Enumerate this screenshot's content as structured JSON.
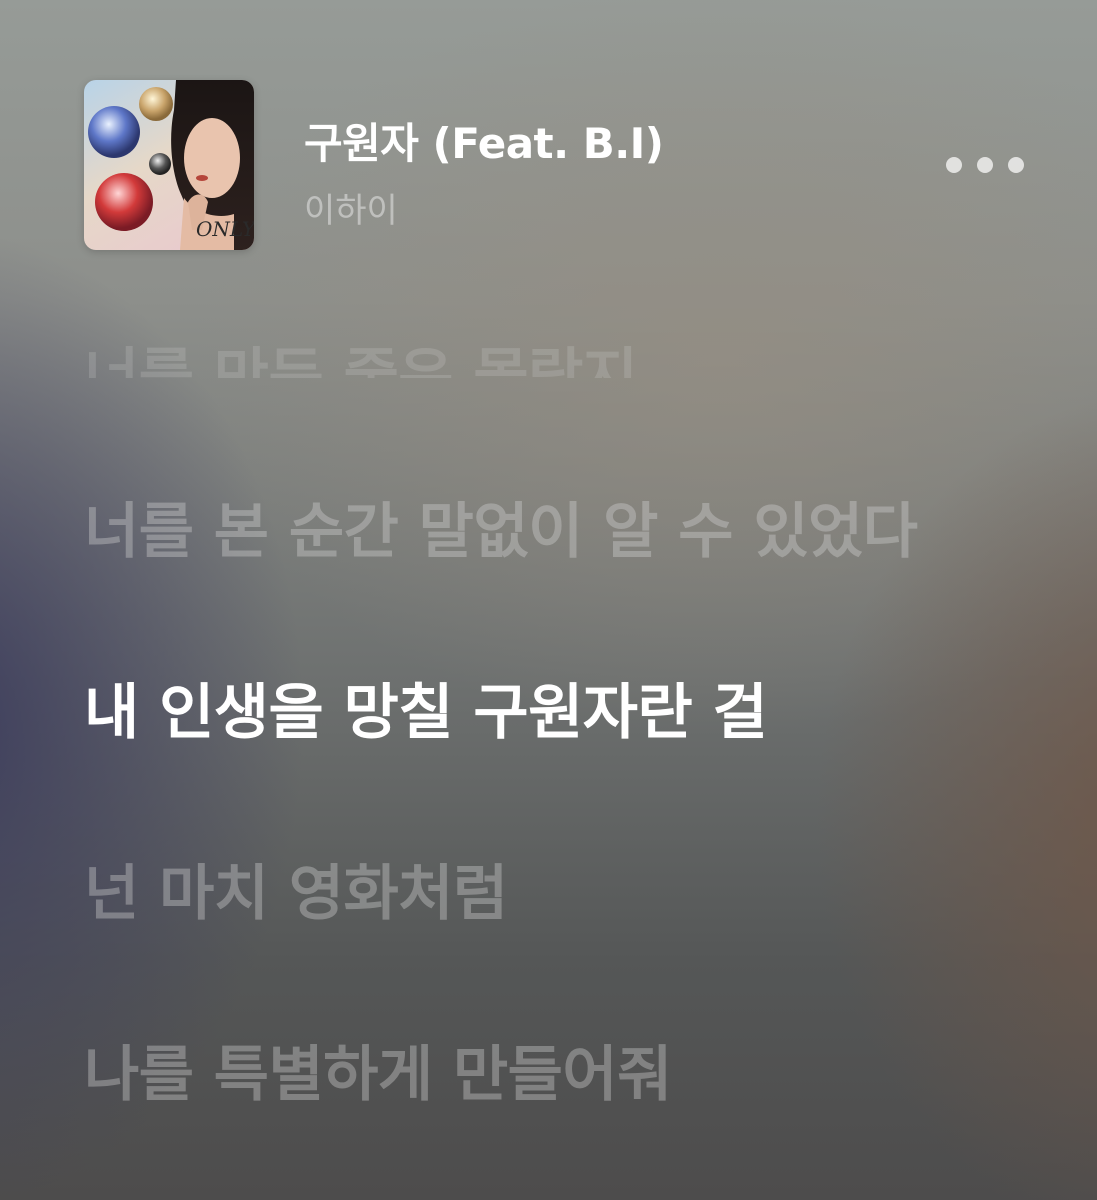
{
  "song": {
    "title": "구원자 (Feat. B.I)",
    "artist": "이하이",
    "album_art_icon": "album-cover",
    "album_art_text": "ONLY"
  },
  "more_menu_icon": "more-horizontal-icon",
  "lyrics": {
    "previous_partial": "너를 만든 줄은 몰랐지",
    "lines": [
      "너를 본 순간 말없이 알 수 있었다",
      "내 인생을 망칠 구원자란 걸",
      "넌 마치 영화처럼",
      "나를 특별하게 만들어줘"
    ],
    "active_index": 1
  },
  "colors": {
    "title": "#ffffff",
    "artist": "#d8d8d8",
    "active_lyric": "#ffffff",
    "inactive_lyric": "#cfcfcf"
  }
}
